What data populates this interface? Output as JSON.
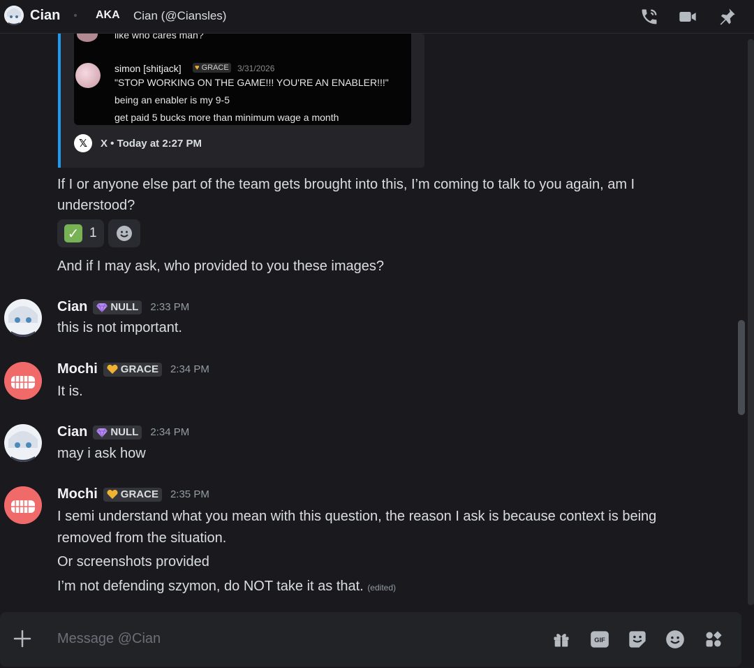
{
  "header": {
    "name": "Cian",
    "aka_label": "AKA",
    "aka_name": "Cian (@Ciansles)",
    "icons": [
      "phone-call-icon",
      "video-camera-icon",
      "pin-icon"
    ]
  },
  "embed": {
    "tweet_lines": {
      "top_line": "like who cares man?",
      "user": "simon [shitjack]",
      "badge": "GRACE",
      "date": "3/31/2026",
      "line1": "\"STOP WORKING ON THE GAME!!! YOU'RE AN ENABLER!!!\"",
      "line2": "being an enabler is my 9-5",
      "line3": "get paid 5 bucks more than minimum wage a month"
    },
    "footer_text": "X • Today at 2:27 PM",
    "accent_color": "#1d9bf0"
  },
  "messages_top": {
    "line1": "If I or anyone else part of the team gets brought into this, I’m coming to talk to you again, am I",
    "line2": "understood?",
    "reaction_count": "1",
    "line3": "And if I may ask, who provided to you these images?"
  },
  "messages": [
    {
      "user": "Cian",
      "tag": "NULL",
      "time": "2:33 PM",
      "lines": [
        "this is not important."
      ]
    },
    {
      "user": "Mochi",
      "tag": "GRACE",
      "time": "2:34 PM",
      "lines": [
        "It is."
      ]
    },
    {
      "user": "Cian",
      "tag": "NULL",
      "time": "2:34 PM",
      "lines": [
        "may i ask how"
      ]
    },
    {
      "user": "Mochi",
      "tag": "GRACE",
      "time": "2:35 PM",
      "lines": [
        "I semi understand what you mean with this question, the reason I ask is because context is being",
        "removed from the situation.",
        "Or screenshots provided",
        "I’m not defending szymon, do NOT take it as that."
      ],
      "edited": "(edited)"
    }
  ],
  "composer": {
    "placeholder": "Message @Cian",
    "icons": [
      "gift-icon",
      "gif-icon",
      "sticker-icon",
      "emoji-icon",
      "apps-icon"
    ],
    "gif_label": "GIF"
  },
  "colors": {
    "background": "#1a1a1e",
    "null_gem": "#b98af0",
    "grace_heart": "#f0b232"
  }
}
